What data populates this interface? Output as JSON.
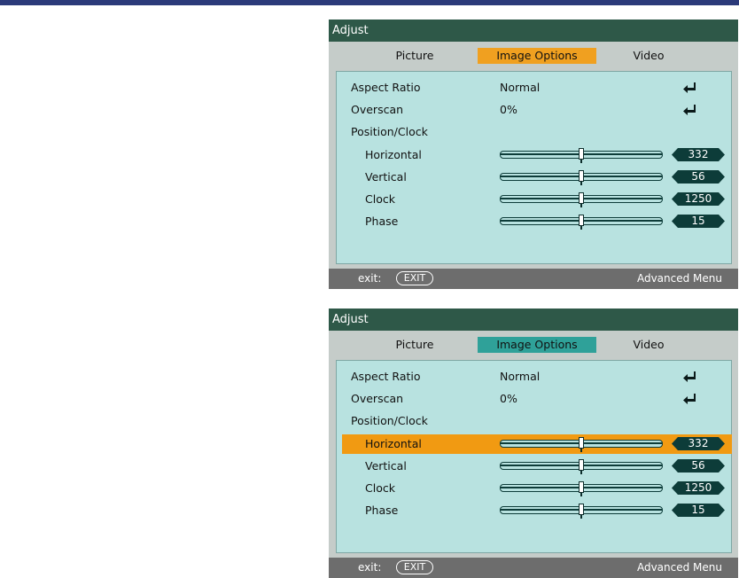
{
  "panels": [
    {
      "title": "Adjust",
      "tabs": [
        "Picture",
        "Image Options",
        "Video"
      ],
      "active_tab": "Image Options",
      "tab_color": "#f0a020",
      "rows": {
        "aspect_ratio": {
          "label": "Aspect Ratio",
          "value": "Normal",
          "icon": "enter-icon"
        },
        "overscan": {
          "label": "Overscan",
          "value": "0%",
          "icon": "enter-icon"
        },
        "position_clock": {
          "label": "Position/Clock"
        },
        "horizontal": {
          "label": "Horizontal",
          "value": "332",
          "slider_fraction": 0.5
        },
        "vertical": {
          "label": "Vertical",
          "value": "56",
          "slider_fraction": 0.5
        },
        "clock": {
          "label": "Clock",
          "value": "1250",
          "slider_fraction": 0.5
        },
        "phase": {
          "label": "Phase",
          "value": "15",
          "slider_fraction": 0.5
        }
      },
      "footer": {
        "exit_label": "exit:",
        "exit_button": "EXIT",
        "advanced": "Advanced Menu"
      }
    },
    {
      "title": "Adjust",
      "tabs": [
        "Picture",
        "Image Options",
        "Video"
      ],
      "active_tab": "Image Options",
      "tab_color": "#2fa199",
      "selected_row": "Horizontal",
      "highlight_color": "#f19a12",
      "rows": {
        "aspect_ratio": {
          "label": "Aspect Ratio",
          "value": "Normal",
          "icon": "enter-icon"
        },
        "overscan": {
          "label": "Overscan",
          "value": "0%",
          "icon": "enter-icon"
        },
        "position_clock": {
          "label": "Position/Clock"
        },
        "horizontal": {
          "label": "Horizontal",
          "value": "332",
          "slider_fraction": 0.5
        },
        "vertical": {
          "label": "Vertical",
          "value": "56",
          "slider_fraction": 0.5
        },
        "clock": {
          "label": "Clock",
          "value": "1250",
          "slider_fraction": 0.5
        },
        "phase": {
          "label": "Phase",
          "value": "15",
          "slider_fraction": 0.5
        }
      },
      "footer": {
        "exit_label": "exit:",
        "exit_button": "EXIT",
        "advanced": "Advanced Menu"
      }
    }
  ],
  "colors": {
    "titlebar": "#2e5848",
    "content_bg": "#b8e2e0",
    "footer_bg": "#6d6d6d",
    "badge": "#0d3c39",
    "top_accent": "#2b3a7a"
  }
}
